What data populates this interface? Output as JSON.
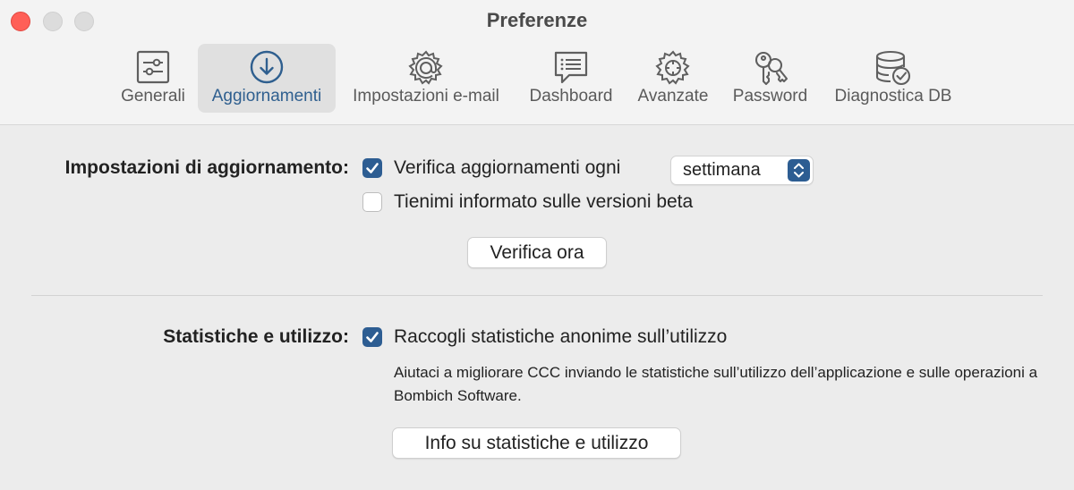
{
  "window": {
    "title": "Preferenze"
  },
  "toolbar": {
    "tabs": [
      {
        "label": "Generali",
        "icon": "sliders-icon"
      },
      {
        "label": "Aggiornamenti",
        "icon": "download-circle-icon",
        "selected": true
      },
      {
        "label": "Impostazioni e-mail",
        "icon": "email-gear-icon"
      },
      {
        "label": "Dashboard",
        "icon": "chat-bubble-icon"
      },
      {
        "label": "Avanzate",
        "icon": "gear-icon"
      },
      {
        "label": "Password",
        "icon": "keys-icon"
      },
      {
        "label": "Diagnostica DB",
        "icon": "database-check-icon"
      }
    ]
  },
  "updates": {
    "section_label": "Impostazioni di aggiornamento:",
    "check_label": "Verifica aggiornamenti ogni",
    "check_checked": true,
    "frequency": "settimana",
    "beta_label": "Tienimi informato sulle versioni beta",
    "beta_checked": false,
    "check_now_button": "Verifica ora"
  },
  "stats": {
    "section_label": "Statistiche e utilizzo:",
    "collect_label": "Raccogli statistiche anonime sull’utilizzo",
    "collect_checked": true,
    "description": "Aiutaci a migliorare CCC inviando le statistiche sull’utilizzo dell’applicazione e sulle operazioni a Bombich Software.",
    "info_button": "Info su statistiche e utilizzo"
  },
  "colors": {
    "accent": "#2d5d92",
    "close": "#ff5f57",
    "selected_tab_bg": "#e0e0e0",
    "selected_tab_text": "#2f5f8f"
  }
}
